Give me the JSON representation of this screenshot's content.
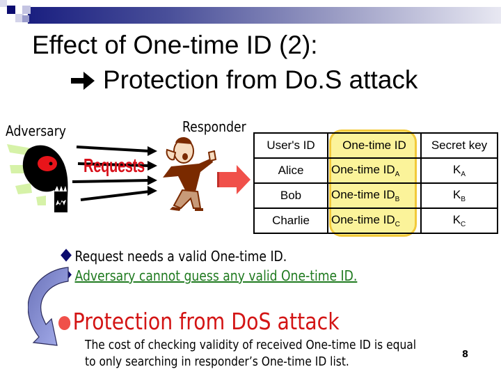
{
  "slide": {
    "title_line1": "Effect of One-time ID (2):",
    "title_line2": "Protection from Do.S attack",
    "title_arrow_icon": "right-arrow-icon",
    "page_number": "8"
  },
  "diagram": {
    "adversary_label": "Adversary",
    "responder_label": "Responder",
    "requests_label": "Requests",
    "colors": {
      "requests": "#d8101a",
      "arrow_to_table": "#f0504a",
      "highlight_fill": "#fbf39a",
      "highlight_border": "#f2c93a"
    }
  },
  "table": {
    "headers": [
      "User's ID",
      "One-time ID",
      "Secret key"
    ],
    "rows": [
      {
        "user": "Alice",
        "otid": "One-time ID",
        "otid_sub": "A",
        "key": "K",
        "key_sub": "A"
      },
      {
        "user": "Bob",
        "otid": "One-time ID",
        "otid_sub": "B",
        "key": "K",
        "key_sub": "B"
      },
      {
        "user": "Charlie",
        "otid": "One-time ID",
        "otid_sub": "C",
        "key": "K",
        "key_sub": "C"
      }
    ]
  },
  "bullets": [
    {
      "text": "Request needs a valid One-time ID.",
      "color": "#000000"
    },
    {
      "text": "Adversary cannot guess any valid One-time ID.",
      "color": "#1f7a1f"
    }
  ],
  "conclusion": {
    "heading": "Protection from DoS attack",
    "heading_color": "#d31414",
    "line1": "The cost of checking validity of received One-time ID is equal",
    "line2": "to only searching in responder’s One-time ID list."
  }
}
